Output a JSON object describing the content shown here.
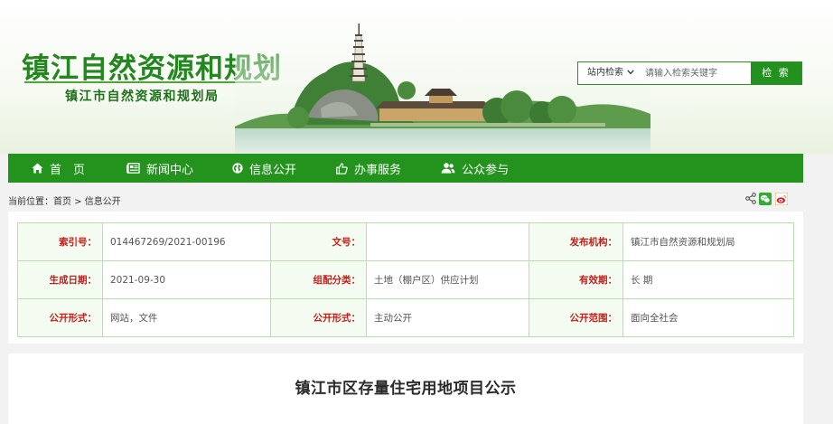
{
  "header": {
    "title": "镇江自然资源和规划",
    "subtitle": "镇江市自然资源和规划局"
  },
  "search": {
    "scope_label": "站内检索",
    "placeholder": "请输入检索关键字",
    "button_label": "检 索"
  },
  "nav": {
    "items": [
      {
        "label": "首　页",
        "icon": "home-icon"
      },
      {
        "label": "新闻中心",
        "icon": "newspaper-icon"
      },
      {
        "label": "信息公开",
        "icon": "globe-icon"
      },
      {
        "label": "办事服务",
        "icon": "thumbs-up-icon"
      },
      {
        "label": "公众参与",
        "icon": "users-icon"
      }
    ]
  },
  "breadcrumb": {
    "prefix": "当前位置：",
    "home": "首页",
    "sep": " > ",
    "current": "信息公开"
  },
  "share": {
    "icons": [
      "share-icon",
      "wechat-icon",
      "weibo-icon"
    ]
  },
  "meta": {
    "rows": [
      [
        {
          "label": "索引号：",
          "value": "014467269/2021-00196"
        },
        {
          "label": "文号：",
          "value": ""
        },
        {
          "label": "发布机构：",
          "value": "镇江市自然资源和规划局"
        }
      ],
      [
        {
          "label": "生成日期：",
          "value": "2021-09-30"
        },
        {
          "label": "组配分类：",
          "value": "土地（棚户区）供应计划"
        },
        {
          "label": "有效期：",
          "value": "长 期"
        }
      ],
      [
        {
          "label": "公开形式：",
          "value": "网站，文件"
        },
        {
          "label": "公开形式：",
          "value": "主动公开"
        },
        {
          "label": "公开范围：",
          "value": "面向全社会"
        }
      ]
    ]
  },
  "article": {
    "title": "镇江市区存量住宅用地项目公示"
  },
  "colors": {
    "brand_green": "#23931d",
    "label_red": "#c0211d",
    "table_border": "#b9deb1"
  }
}
